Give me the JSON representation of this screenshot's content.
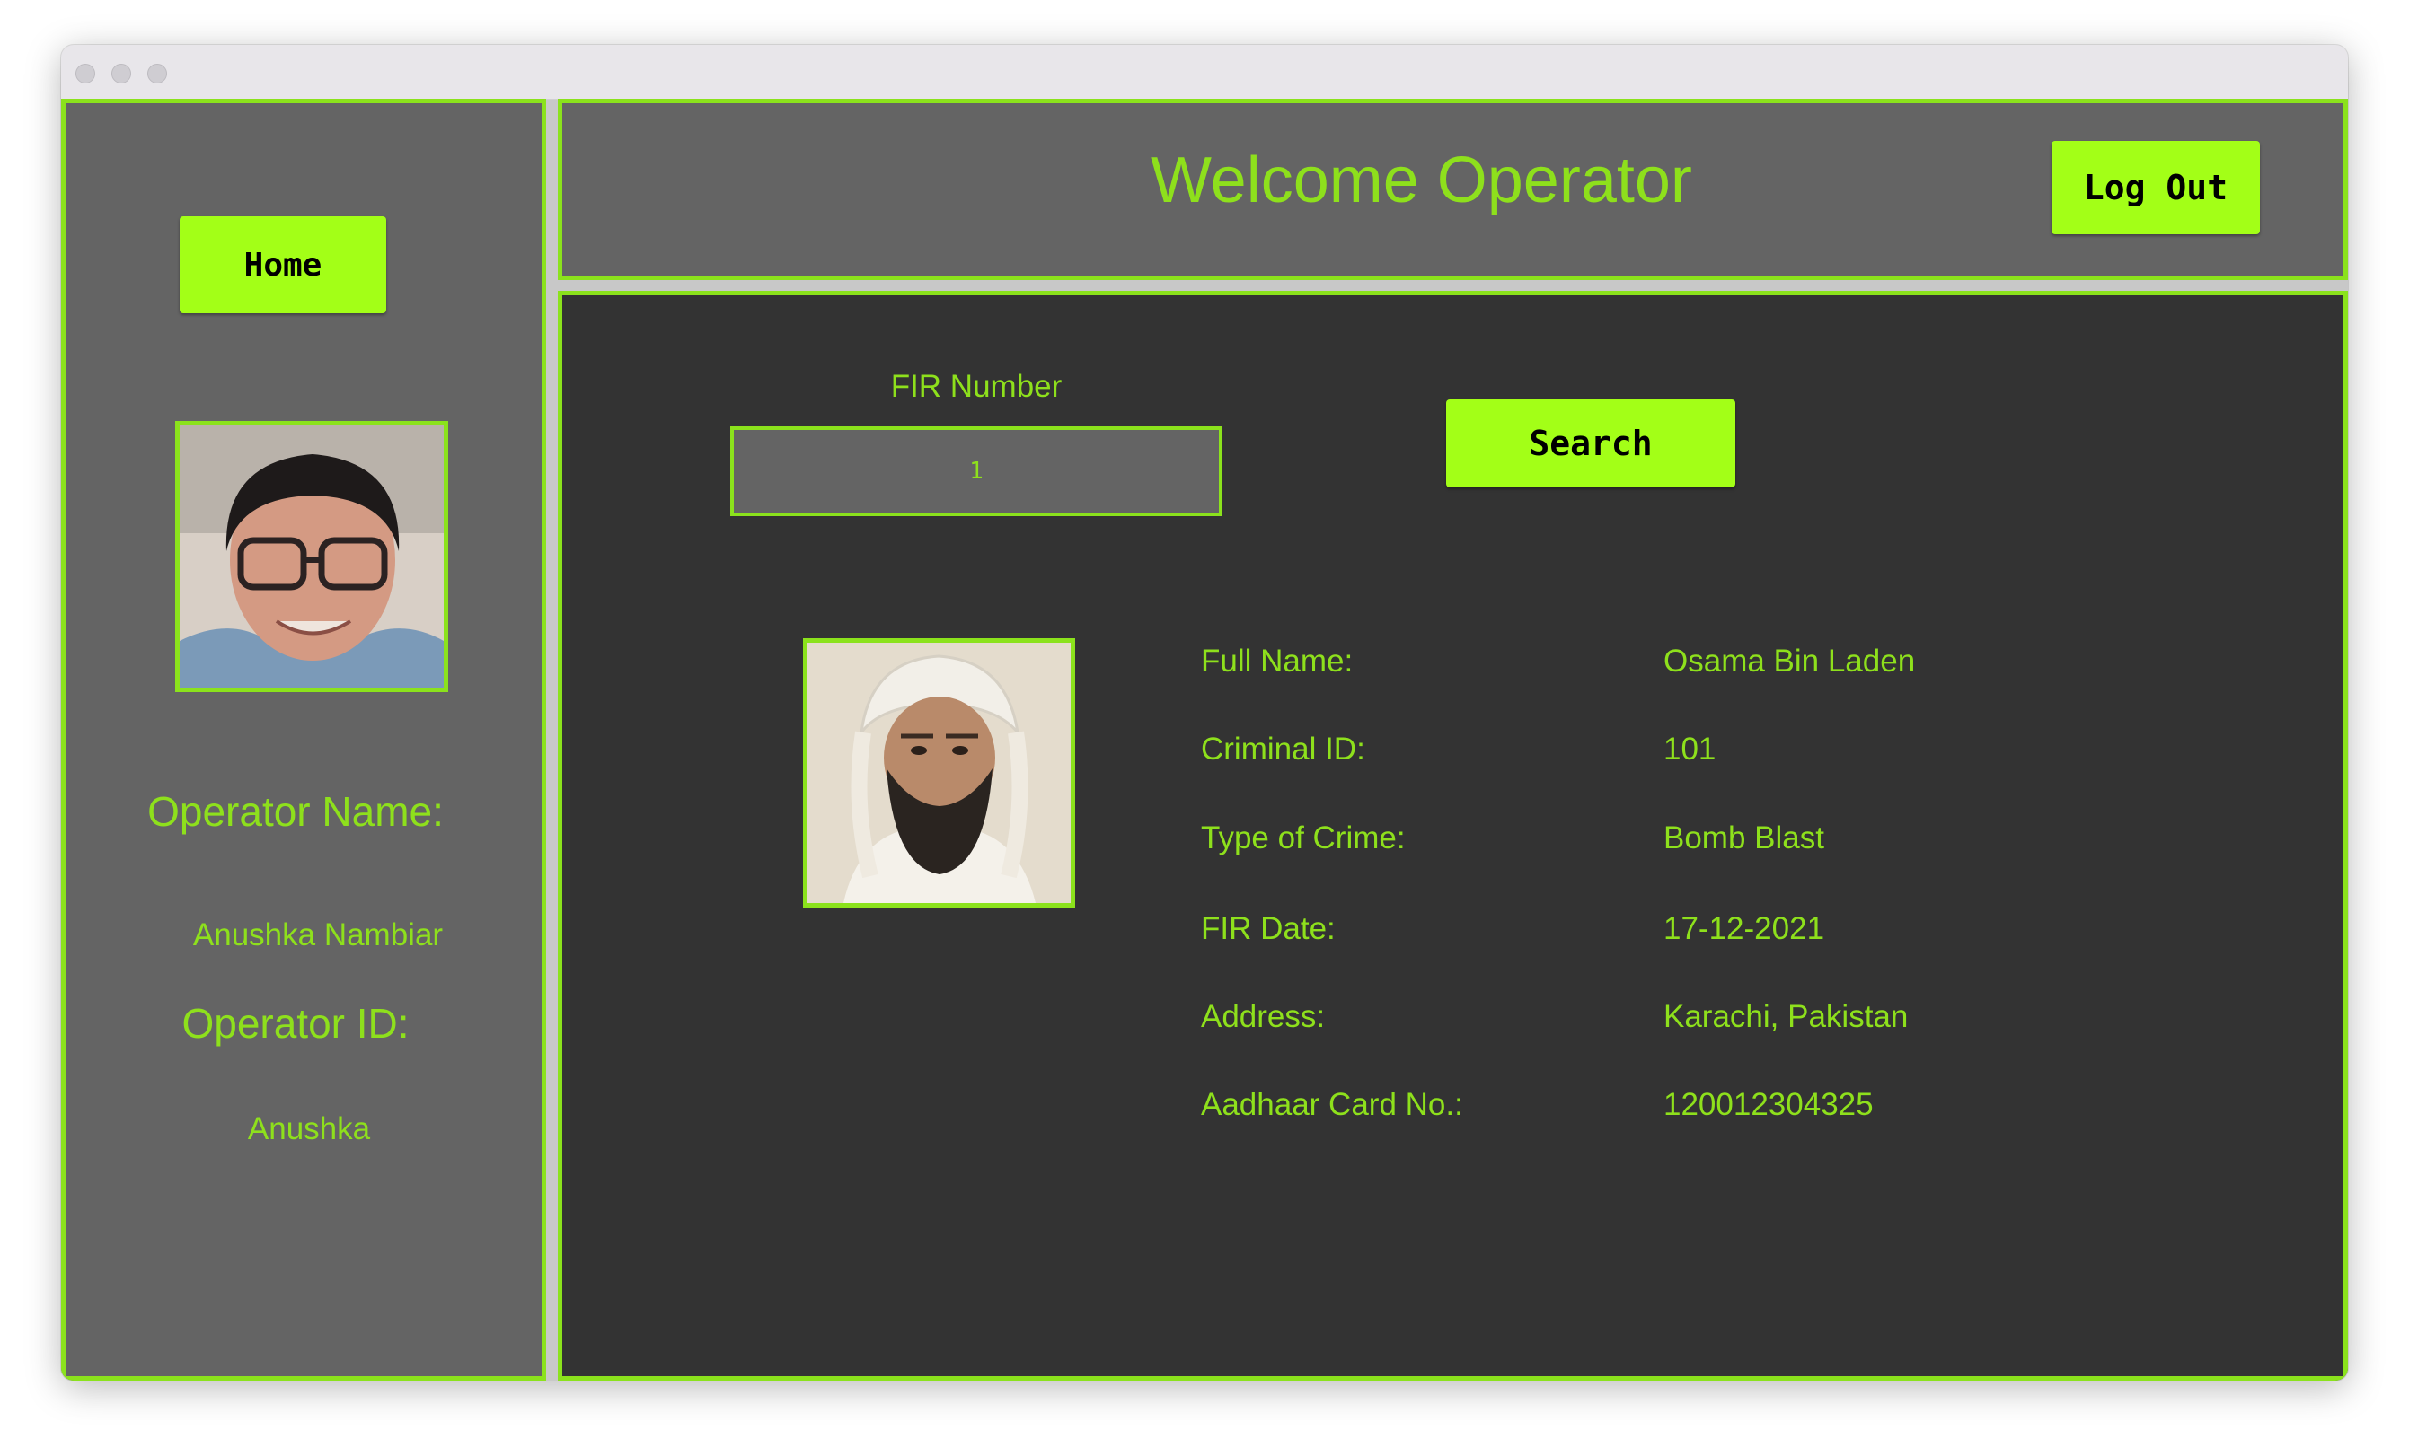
{
  "sidebar": {
    "home_label": "Home",
    "operator_name_label": "Operator Name:",
    "operator_name_value": "Anushka Nambiar",
    "operator_id_label": "Operator ID:",
    "operator_id_value": "Anushka"
  },
  "header": {
    "title": "Welcome Operator",
    "logout_label": "Log Out"
  },
  "search": {
    "fir_label": "FIR Number",
    "fir_value": "1",
    "search_label": "Search"
  },
  "record": {
    "fields": [
      {
        "label": "Full Name:",
        "value": "Osama Bin Laden"
      },
      {
        "label": "Criminal ID:",
        "value": "101"
      },
      {
        "label": "Type of Crime:",
        "value": "Bomb Blast"
      },
      {
        "label": "FIR Date:",
        "value": "17-12-2021"
      },
      {
        "label": "Address:",
        "value": "Karachi, Pakistan"
      },
      {
        "label": "Aadhaar Card No.:",
        "value": "120012304325"
      }
    ]
  },
  "colors": {
    "accent": "#8be21c",
    "button": "#a3ff17",
    "panel": "#646464",
    "main_bg": "#333333"
  }
}
